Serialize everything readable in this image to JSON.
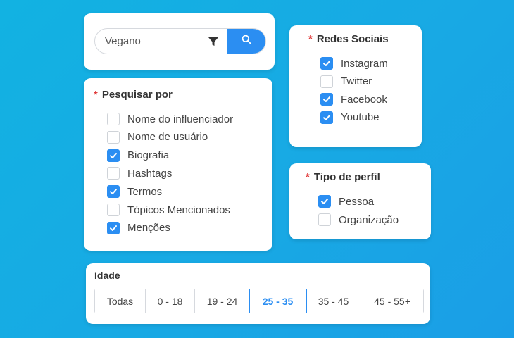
{
  "colors": {
    "accent": "#2b8ef2",
    "required": "#e03a3a",
    "background": "#14a8e3"
  },
  "search": {
    "value": "Vegano",
    "filter_icon": "filter-icon",
    "button_icon": "search-icon"
  },
  "search_by": {
    "title": "Pesquisar por",
    "items": [
      {
        "label": "Nome do influenciador",
        "checked": false
      },
      {
        "label": "Nome de usuário",
        "checked": false
      },
      {
        "label": "Biografia",
        "checked": true
      },
      {
        "label": "Hashtags",
        "checked": false
      },
      {
        "label": "Termos",
        "checked": true
      },
      {
        "label": "Tópicos Mencionados",
        "checked": false
      },
      {
        "label": "Menções",
        "checked": true
      }
    ]
  },
  "social": {
    "title": "Redes Sociais",
    "items": [
      {
        "label": "Instagram",
        "checked": true
      },
      {
        "label": "Twitter",
        "checked": false
      },
      {
        "label": "Facebook",
        "checked": true
      },
      {
        "label": "Youtube",
        "checked": true
      }
    ]
  },
  "profile": {
    "title": "Tipo de perfil",
    "items": [
      {
        "label": "Pessoa",
        "checked": true
      },
      {
        "label": "Organização",
        "checked": false
      }
    ]
  },
  "age": {
    "title": "Idade",
    "options": [
      "Todas",
      "0 - 18",
      "19 - 24",
      "25 - 35",
      "35 - 45",
      "45 - 55+"
    ],
    "selected": "25 - 35"
  }
}
